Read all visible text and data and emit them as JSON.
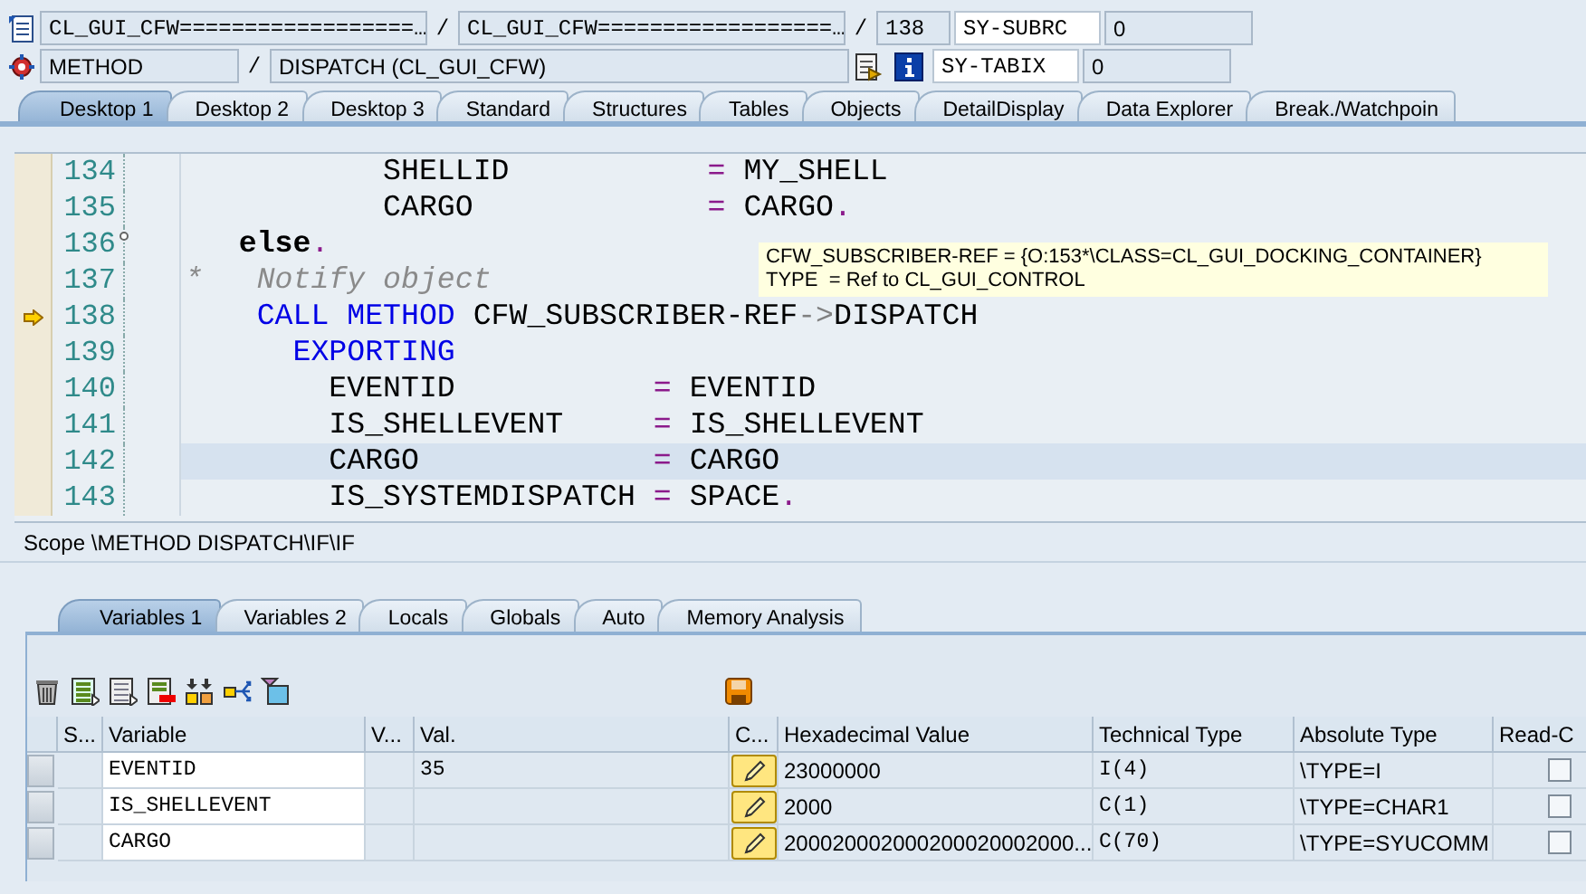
{
  "context": {
    "program": "CL_GUI_CFW==================…",
    "include": "CL_GUI_CFW==================…",
    "line": "138",
    "event_type": "METHOD",
    "event": "DISPATCH (CL_GUI_CFW)",
    "separators": [
      "/",
      "/",
      "/"
    ]
  },
  "system_fields": [
    {
      "name": "SY-SUBRC",
      "value": "0"
    },
    {
      "name": "SY-TABIX",
      "value": "0"
    }
  ],
  "desktop_tabs": [
    {
      "label": "Desktop 1",
      "selected": true
    },
    {
      "label": "Desktop 2",
      "selected": false
    },
    {
      "label": "Desktop 3",
      "selected": false
    },
    {
      "label": "Standard",
      "selected": false
    },
    {
      "label": "Structures",
      "selected": false
    },
    {
      "label": "Tables",
      "selected": false
    },
    {
      "label": "Objects",
      "selected": false
    },
    {
      "label": "DetailDisplay",
      "selected": false
    },
    {
      "label": "Data Explorer",
      "selected": false
    },
    {
      "label": "Break./Watchpoin",
      "selected": false
    }
  ],
  "editor": {
    "lines": [
      {
        "number": "134",
        "current": false,
        "highlighted": false,
        "fold": false,
        "segments": [
          {
            "kind": "plain",
            "text": "           SHELLID           "
          },
          {
            "kind": "operator",
            "text": "="
          },
          {
            "kind": "plain",
            "text": " MY_SHELL"
          }
        ]
      },
      {
        "number": "135",
        "current": false,
        "highlighted": false,
        "fold": false,
        "segments": [
          {
            "kind": "plain",
            "text": "           CARGO             "
          },
          {
            "kind": "operator",
            "text": "="
          },
          {
            "kind": "plain",
            "text": " CARGO"
          },
          {
            "kind": "operator",
            "text": "."
          }
        ]
      },
      {
        "number": "136",
        "current": false,
        "highlighted": false,
        "fold": true,
        "segments": [
          {
            "kind": "statement",
            "text": "   else"
          },
          {
            "kind": "operator",
            "text": "."
          }
        ]
      },
      {
        "number": "137",
        "current": false,
        "highlighted": false,
        "fold": false,
        "segments": [
          {
            "kind": "comment",
            "text": "*   Notify object"
          }
        ]
      },
      {
        "number": "138",
        "current": true,
        "highlighted": false,
        "fold": false,
        "segments": [
          {
            "kind": "keyword",
            "text": "    CALL METHOD"
          },
          {
            "kind": "plain",
            "text": " CFW_SUBSCRIBER-REF"
          },
          {
            "kind": "pointer",
            "text": "->"
          },
          {
            "kind": "plain",
            "text": "DISPATCH"
          }
        ]
      },
      {
        "number": "139",
        "current": false,
        "highlighted": false,
        "fold": false,
        "segments": [
          {
            "kind": "keyword",
            "text": "      EXPORTING"
          }
        ]
      },
      {
        "number": "140",
        "current": false,
        "highlighted": false,
        "fold": false,
        "segments": [
          {
            "kind": "plain",
            "text": "        EVENTID           "
          },
          {
            "kind": "operator",
            "text": "="
          },
          {
            "kind": "plain",
            "text": " EVENTID"
          }
        ]
      },
      {
        "number": "141",
        "current": false,
        "highlighted": false,
        "fold": false,
        "segments": [
          {
            "kind": "plain",
            "text": "        IS_SHELLEVENT     "
          },
          {
            "kind": "operator",
            "text": "="
          },
          {
            "kind": "plain",
            "text": " IS_SHELLEVENT"
          }
        ]
      },
      {
        "number": "142",
        "current": false,
        "highlighted": true,
        "fold": false,
        "segments": [
          {
            "kind": "plain",
            "text": "        CARGO             "
          },
          {
            "kind": "operator",
            "text": "="
          },
          {
            "kind": "plain",
            "text": " CARGO"
          }
        ]
      },
      {
        "number": "143",
        "current": false,
        "highlighted": false,
        "fold": false,
        "segments": [
          {
            "kind": "plain",
            "text": "        IS_SYSTEMDISPATCH "
          },
          {
            "kind": "operator",
            "text": "="
          },
          {
            "kind": "plain",
            "text": " SPACE"
          },
          {
            "kind": "operator",
            "text": "."
          }
        ]
      }
    ],
    "tooltip": [
      "CFW_SUBSCRIBER-REF = {O:153*\\CLASS=CL_GUI_DOCKING_CONTAINER}",
      "TYPE  = Ref to CL_GUI_CONTROL"
    ]
  },
  "scope": "Scope \\METHOD DISPATCH\\IF\\IF",
  "variable_tabs": [
    {
      "label": "Variables 1",
      "selected": true
    },
    {
      "label": "Variables 2",
      "selected": false
    },
    {
      "label": "Locals",
      "selected": false
    },
    {
      "label": "Globals",
      "selected": false
    },
    {
      "label": "Auto",
      "selected": false
    },
    {
      "label": "Memory Analysis",
      "selected": false
    }
  ],
  "variables_table": {
    "columns": [
      "S...",
      "Variable",
      "V...",
      "Val.",
      "C...",
      "Hexadecimal Value",
      "Technical Type",
      "Absolute Type",
      "Read-C"
    ],
    "rows": [
      {
        "variable": "EVENTID",
        "value": "35",
        "hexadecimal_value": "23000000",
        "technical_type": "I(4)",
        "absolute_type": "\\TYPE=I",
        "read_only": false
      },
      {
        "variable": "IS_SHELLEVENT",
        "hexadecimal_value": "2000",
        "technical_type": "C(1)",
        "absolute_type": "\\TYPE=CHAR1",
        "read_only": false
      },
      {
        "variable": "CARGO",
        "hexadecimal_value": "200020002000200020002000...",
        "technical_type": "C(70)",
        "absolute_type": "\\TYPE=SYUCOMM",
        "read_only": false
      }
    ]
  }
}
